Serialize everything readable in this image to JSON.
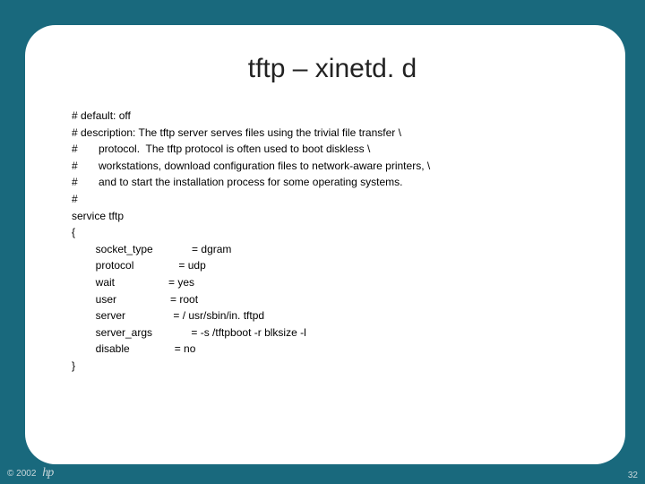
{
  "title": "tftp – xinetd. d",
  "lines": [
    "# default: off",
    "# description: The tftp server serves files using the trivial file transfer \\",
    "#       protocol.  The tftp protocol is often used to boot diskless \\",
    "#       workstations, download configuration files to network-aware printers, \\",
    "#       and to start the installation process for some operating systems.",
    "#",
    "service tftp",
    "{",
    "        socket_type             = dgram",
    "        protocol               = udp",
    "        wait                  = yes",
    "        user                  = root",
    "        server                = / usr/sbin/in. tftpd",
    "        server_args             = -s /tftpboot -r blksize -l",
    "        disable               = no",
    "}"
  ],
  "footer": {
    "copyright": "© 2002",
    "brand": "hp"
  },
  "page_number": "32"
}
